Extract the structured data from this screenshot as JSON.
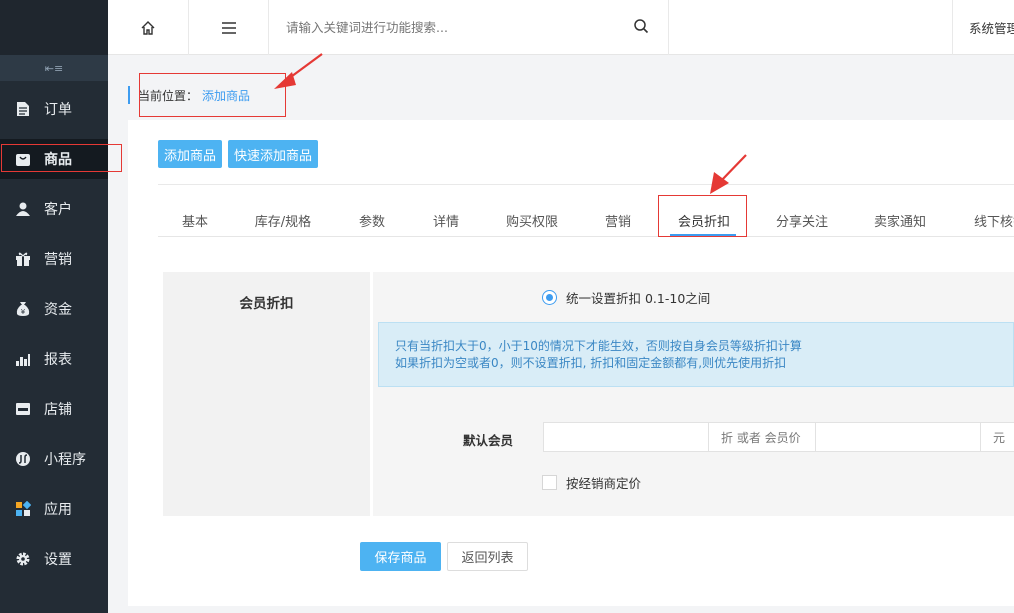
{
  "sidebar": {
    "collapse_glyph": "⇤≡",
    "items": [
      {
        "label": "订单",
        "icon": "order-icon"
      },
      {
        "label": "商品",
        "icon": "goods-icon"
      },
      {
        "label": "客户",
        "icon": "customer-icon"
      },
      {
        "label": "营销",
        "icon": "gift-icon"
      },
      {
        "label": "资金",
        "icon": "money-bag-icon"
      },
      {
        "label": "报表",
        "icon": "bar-chart-icon"
      },
      {
        "label": "店铺",
        "icon": "store-icon"
      },
      {
        "label": "小程序",
        "icon": "mini-program-icon"
      },
      {
        "label": "应用",
        "icon": "apps-icon"
      },
      {
        "label": "设置",
        "icon": "gear-icon"
      }
    ],
    "active": "商品"
  },
  "topbar": {
    "search_placeholder": "请输入关键词进行功能搜索...",
    "system_link": "系统管理"
  },
  "breadcrumb": {
    "prefix": "当前位置：",
    "current": "添加商品"
  },
  "actions": {
    "add_goods": "添加商品",
    "quick_add_goods": "快速添加商品"
  },
  "tabs": [
    "基本",
    "库存/规格",
    "参数",
    "详情",
    "购买权限",
    "营销",
    "会员折扣",
    "分享关注",
    "卖家通知",
    "线下核销"
  ],
  "active_tab": "会员折扣",
  "form": {
    "section_title": "会员折扣",
    "radio_label": "统一设置折扣 0.1-10之间",
    "info_line1": "只有当折扣大于0，小于10的情况下才能生效，否则按自身会员等级折扣计算",
    "info_line2": "如果折扣为空或者0，则不设置折扣, 折扣和固定金额都有,则优先使用折扣",
    "default_member_label": "默认会员",
    "discount_value": "",
    "discount_addon": "折 或者 会员价",
    "price_value": "",
    "price_addon": "元",
    "checkbox_label": "按经销商定价"
  },
  "buttons": {
    "save": "保存商品",
    "back": "返回列表"
  },
  "colors": {
    "sidebar_bg": "#232c35",
    "accent": "#4db3f2",
    "info_bg": "#d9edf7",
    "annotation": "#e53935"
  }
}
